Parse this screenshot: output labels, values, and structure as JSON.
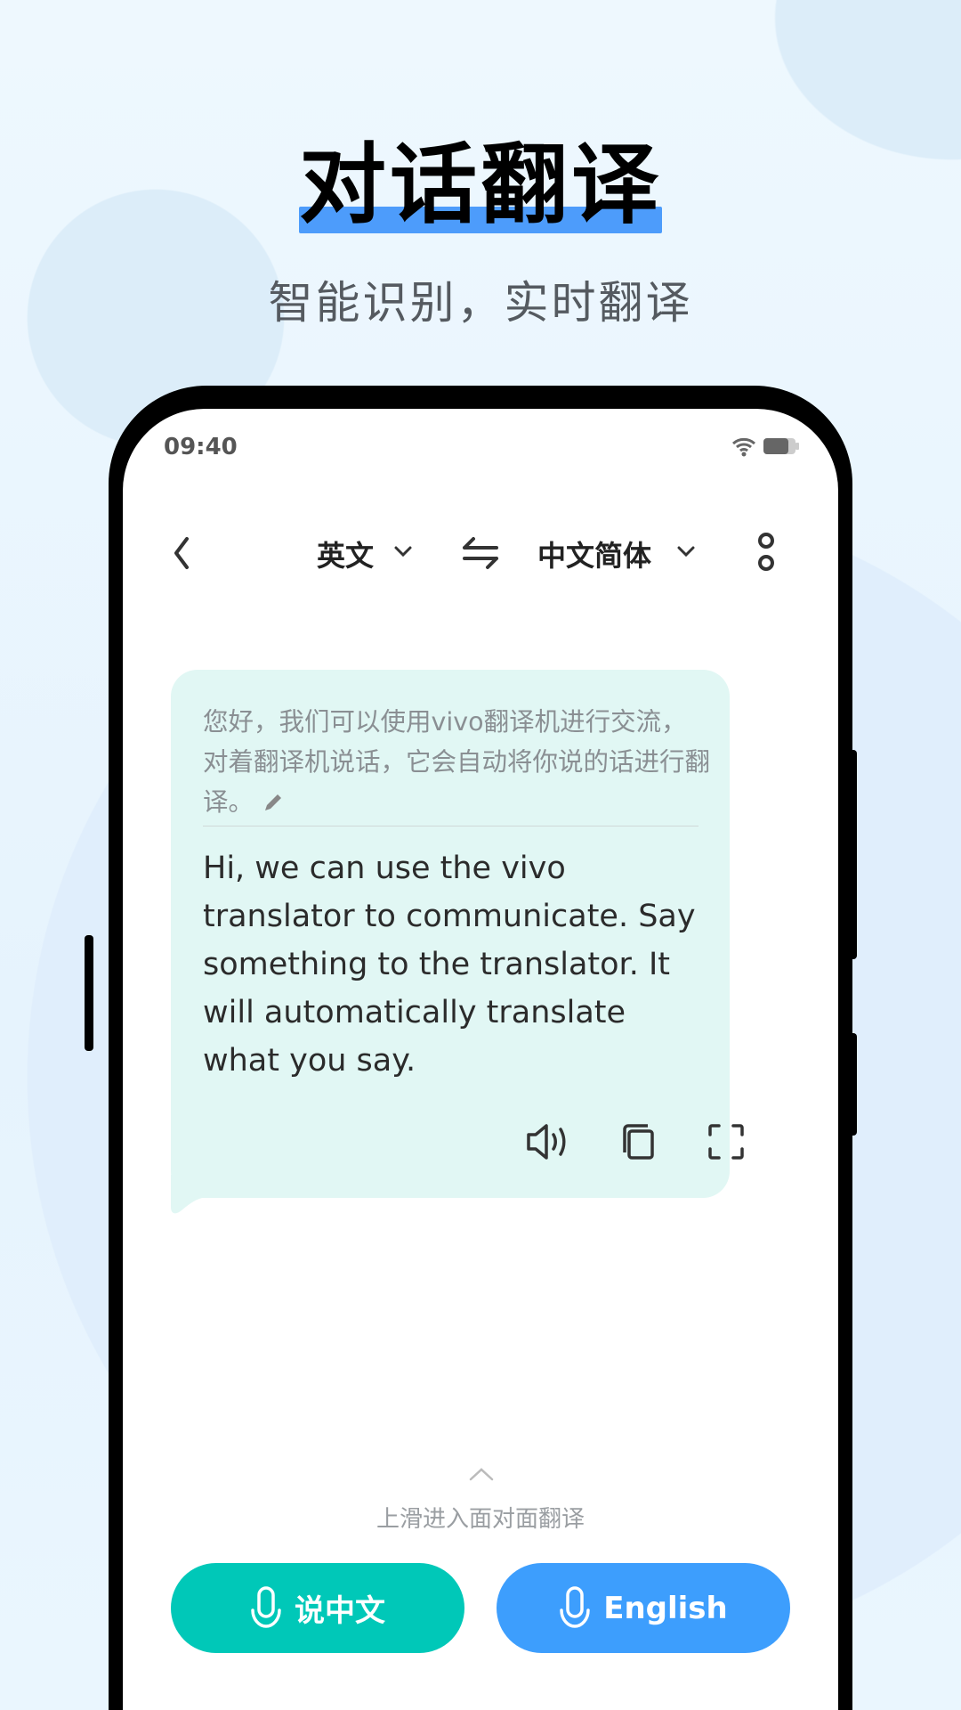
{
  "promo": {
    "title": "对话翻译",
    "subtitle": "智能识别，实时翻译"
  },
  "status_bar": {
    "time": "09:40",
    "icons": [
      "wifi-icon",
      "battery-icon"
    ]
  },
  "toolbar": {
    "source_lang": "英文",
    "target_lang": "中文简体",
    "icons": [
      "back-icon",
      "chevron-down-icon",
      "swap-icon",
      "more-icon"
    ]
  },
  "message": {
    "source_text": "您好，我们可以使用vivo翻译机进行交流，对着翻译机说话，它会自动将你说的话进行翻译。",
    "translated_text": "Hi, we can use the vivo translator to communicate. Say something to the translator. It will  automatically translate what you say.",
    "actions": [
      "speaker-icon",
      "copy-icon",
      "fullscreen-icon"
    ]
  },
  "hint": "上滑进入面对面翻译",
  "buttons": {
    "speak_chinese": "说中文",
    "speak_english": "English"
  },
  "colors": {
    "accent_teal": "#00c8b8",
    "accent_blue": "#3d9efd",
    "bubble": "#e1f7f4",
    "highlight": "#4d9cfb"
  }
}
